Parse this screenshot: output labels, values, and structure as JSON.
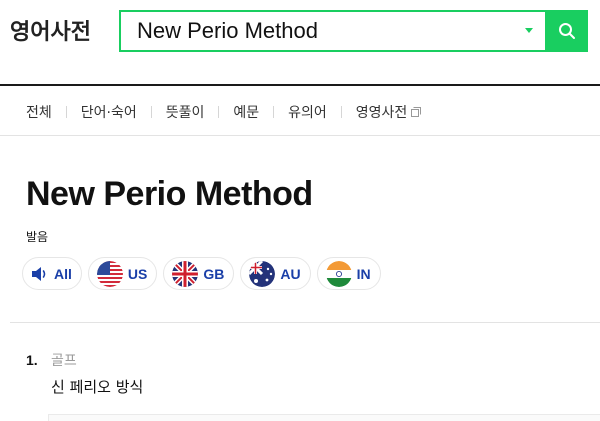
{
  "header": {
    "logo": "영어사전",
    "search": {
      "value": "New Perio Method",
      "placeholder": ""
    }
  },
  "tabs": [
    {
      "label": "전체"
    },
    {
      "label": "단어·숙어"
    },
    {
      "label": "뜻풀이"
    },
    {
      "label": "예문"
    },
    {
      "label": "유의어"
    },
    {
      "label": "영영사전"
    }
  ],
  "entry": {
    "word": "New Perio Method",
    "pronunciation_label": "발음",
    "pronunciations": [
      {
        "label": "All",
        "icon": "speaker-icon"
      },
      {
        "label": "US",
        "icon": "us-flag-icon"
      },
      {
        "label": "GB",
        "icon": "gb-flag-icon"
      },
      {
        "label": "AU",
        "icon": "au-flag-icon"
      },
      {
        "label": "IN",
        "icon": "in-flag-icon"
      }
    ],
    "meanings": [
      {
        "number": "1.",
        "category": "골프",
        "definition": "신 페리오 방식"
      }
    ]
  },
  "colors": {
    "accent": "#19ce60",
    "pron_text": "#1a3fa8"
  }
}
